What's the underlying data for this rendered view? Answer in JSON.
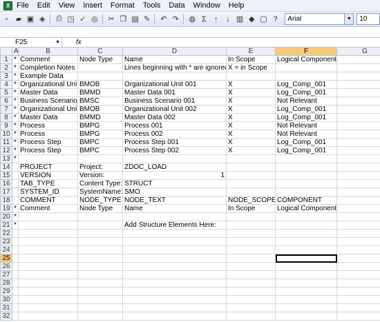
{
  "menu": [
    "File",
    "Edit",
    "View",
    "Insert",
    "Format",
    "Tools",
    "Data",
    "Window",
    "Help"
  ],
  "toolbar": {
    "font_name": "Arial",
    "font_size": "10"
  },
  "name_box": "F25",
  "fx_label": "fx",
  "columns": [
    "A",
    "B",
    "C",
    "D",
    "E",
    "F",
    "G"
  ],
  "rows": [
    {
      "n": "1",
      "a": "*",
      "b": "Comment",
      "c": "Node Type",
      "d": "Name",
      "e": "In Scope",
      "f": "Logical Component",
      "g": ""
    },
    {
      "n": "2",
      "a": "*",
      "b": "Completion Notes",
      "c": "",
      "d": "Lines beginning with * are ignored",
      "e": "X = in Scope",
      "f": "",
      "g": ""
    },
    {
      "n": "3",
      "a": "*",
      "b": "Example Data",
      "c": "",
      "d": "",
      "e": "",
      "f": "",
      "g": ""
    },
    {
      "n": "4",
      "a": "*",
      "b": "Organizational Unit",
      "c": "BMOB",
      "d": "Organizational Unit 001",
      "e": "X",
      "f": "Log_Comp_001",
      "g": ""
    },
    {
      "n": "5",
      "a": "*",
      "b": "Master Data",
      "c": "BMMD",
      "d": "Master Data 001",
      "e": "X",
      "f": "Log_Comp_001",
      "g": ""
    },
    {
      "n": "6",
      "a": "*",
      "b": "Business Scenario",
      "c": "BMSC",
      "d": "Business Scenario 001",
      "e": "X",
      "f": "Not Relevant",
      "g": ""
    },
    {
      "n": "7",
      "a": "*",
      "b": "Organizational Unit",
      "c": "BMOB",
      "d": "Organizational Unit 002",
      "e": "X",
      "f": "Log_Comp_001",
      "g": ""
    },
    {
      "n": "8",
      "a": "*",
      "b": "Master Data",
      "c": "BMMD",
      "d": "Master Data 002",
      "e": "X",
      "f": "Log_Comp_001",
      "g": ""
    },
    {
      "n": "9",
      "a": "*",
      "b": "Process",
      "c": "BMPG",
      "d": "Process 001",
      "e": "X",
      "f": "Not Relevant",
      "g": ""
    },
    {
      "n": "10",
      "a": "*",
      "b": "Process",
      "c": "BMPG",
      "d": "Process 002",
      "e": "X",
      "f": "Not Relevant",
      "g": ""
    },
    {
      "n": "11",
      "a": "*",
      "b": "Process Step",
      "c": "BMPC",
      "d": "Process Step 001",
      "e": "X",
      "f": "Log_Comp_001",
      "g": ""
    },
    {
      "n": "12",
      "a": "*",
      "b": "Process Step",
      "c": "BMPC",
      "d": "Process Step 002",
      "e": "X",
      "f": "Log_Comp_001",
      "g": ""
    },
    {
      "n": "13",
      "a": "*",
      "b": "",
      "c": "",
      "d": "",
      "e": "",
      "f": "",
      "g": ""
    },
    {
      "n": "14",
      "a": "",
      "b": "PROJECT",
      "c": "Project:",
      "d": "ZDOC_LOAD",
      "e": "",
      "f": "",
      "g": ""
    },
    {
      "n": "15",
      "a": "",
      "b": "VERSION",
      "c": "Version:",
      "d": "1",
      "e": "",
      "f": "",
      "g": ""
    },
    {
      "n": "16",
      "a": "",
      "b": "TAB_TYPE",
      "c": "Content Type:",
      "d": "STRUCT",
      "e": "",
      "f": "",
      "g": ""
    },
    {
      "n": "17",
      "a": "",
      "b": "SYSTEM_ID",
      "c": "SystemName:",
      "d": "SMO",
      "e": "",
      "f": "",
      "g": ""
    },
    {
      "n": "18",
      "a": "",
      "b": "COMMENT",
      "c": "NODE_TYPE",
      "d": "NODE_TEXT",
      "e": "NODE_SCOPE",
      "f": "COMPONENT",
      "g": ""
    },
    {
      "n": "19",
      "a": "*",
      "b": "Comment",
      "c": "Node Type",
      "d": "Name",
      "e": "In Scope",
      "f": "Logical Component",
      "g": ""
    },
    {
      "n": "20",
      "a": "*",
      "b": "",
      "c": "",
      "d": "",
      "e": "",
      "f": "",
      "g": ""
    },
    {
      "n": "21",
      "a": "*",
      "b": "",
      "c": "",
      "d": "Add Structure Elements Here:",
      "e": "",
      "f": "",
      "g": ""
    },
    {
      "n": "22",
      "a": "",
      "b": "",
      "c": "",
      "d": "",
      "e": "",
      "f": "",
      "g": ""
    },
    {
      "n": "23",
      "a": "",
      "b": "",
      "c": "",
      "d": "",
      "e": "",
      "f": "",
      "g": ""
    },
    {
      "n": "24",
      "a": "",
      "b": "",
      "c": "",
      "d": "",
      "e": "",
      "f": "",
      "g": ""
    },
    {
      "n": "25",
      "a": "",
      "b": "",
      "c": "",
      "d": "",
      "e": "",
      "f": "",
      "g": ""
    },
    {
      "n": "26",
      "a": "",
      "b": "",
      "c": "",
      "d": "",
      "e": "",
      "f": "",
      "g": ""
    },
    {
      "n": "27",
      "a": "",
      "b": "",
      "c": "",
      "d": "",
      "e": "",
      "f": "",
      "g": ""
    },
    {
      "n": "28",
      "a": "",
      "b": "",
      "c": "",
      "d": "",
      "e": "",
      "f": "",
      "g": ""
    },
    {
      "n": "29",
      "a": "",
      "b": "",
      "c": "",
      "d": "",
      "e": "",
      "f": "",
      "g": ""
    },
    {
      "n": "30",
      "a": "",
      "b": "",
      "c": "",
      "d": "",
      "e": "",
      "f": "",
      "g": ""
    },
    {
      "n": "31",
      "a": "",
      "b": "",
      "c": "",
      "d": "",
      "e": "",
      "f": "",
      "g": ""
    },
    {
      "n": "32",
      "a": "",
      "b": "",
      "c": "",
      "d": "",
      "e": "",
      "f": "",
      "g": ""
    }
  ]
}
